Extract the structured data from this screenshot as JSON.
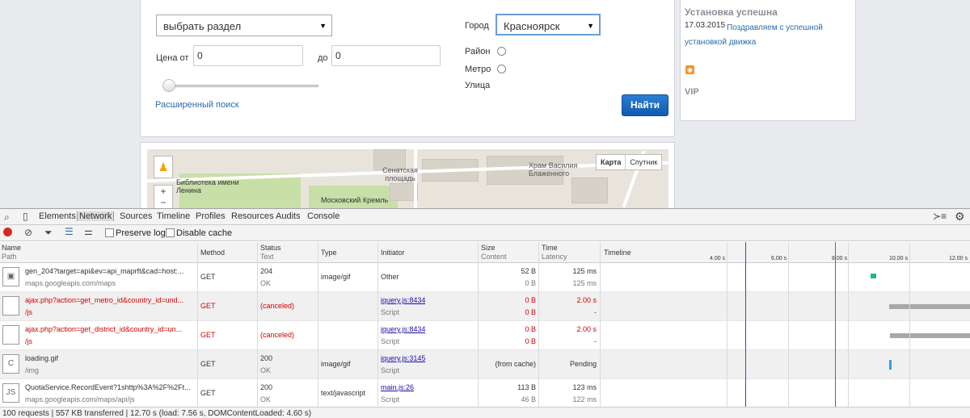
{
  "search": {
    "section_select": "выбрать раздел",
    "city_label": "Город",
    "city_value": "Красноярск",
    "price_from_label": "Цена от",
    "price_from_value": "0",
    "price_to_label": "до",
    "price_to_value": "0",
    "district_label": "Район",
    "metro_label": "Метро",
    "street_label": "Улица",
    "advanced_link": "Расширенный поиск",
    "find_button": "Найти"
  },
  "side": {
    "title": "Установка успешна",
    "date": "17.03.2015",
    "news_text": "Поздравляем с успешной установкой движка",
    "vip": "VIP"
  },
  "map": {
    "labels": [
      "Сенатская площадь",
      "Храм Василия Блаженного",
      "Библиотека имени Ленина",
      "Московский Кремль"
    ],
    "type_map": "Карта",
    "type_satellite": "Спутник"
  },
  "devtools": {
    "tabs": [
      "Elements",
      "Network",
      "Sources",
      "Timeline",
      "Profiles",
      "Resources",
      "Audits",
      "Console"
    ],
    "active_tab": "Network",
    "preserve_log": "Preserve log",
    "disable_cache": "Disable cache",
    "headers": {
      "name": "Name",
      "path": "Path",
      "method": "Method",
      "status": "Status",
      "text": "Text",
      "type": "Type",
      "initiator": "Initiator",
      "size": "Size",
      "content": "Content",
      "time": "Time",
      "latency": "Latency",
      "timeline": "Timeline"
    },
    "ticks": [
      "4.00 s",
      "6.00 s",
      "8.00 s",
      "10.00 s",
      "12.00 s"
    ],
    "rows": [
      {
        "name": "gen_204?target=api&ev=api_maprft&cad=host:...",
        "path": "maps.googleapis.com/maps",
        "method": "GET",
        "status": "204",
        "text": "OK",
        "type": "image/gif",
        "initiator": "Other",
        "initiator_sub": "",
        "size": "52 B",
        "content": "0 B",
        "time": "125 ms",
        "latency": "125 ms",
        "error": false
      },
      {
        "name": "ajax.php?action=get_metro_id&country_id=und...",
        "path": "/js",
        "method": "GET",
        "status": "(canceled)",
        "text": "",
        "type": "",
        "initiator": "jquery.js:8434",
        "initiator_sub": "Script",
        "size": "0 B",
        "content": "0 B",
        "time": "2.00 s",
        "latency": "-",
        "error": true
      },
      {
        "name": "ajax.php?action=get_district_id&country_id=un...",
        "path": "/js",
        "method": "GET",
        "status": "(canceled)",
        "text": "",
        "type": "",
        "initiator": "jquery.js:8434",
        "initiator_sub": "Script",
        "size": "0 B",
        "content": "0 B",
        "time": "2.00 s",
        "latency": "-",
        "error": true
      },
      {
        "name": "loading.gif",
        "path": "/img",
        "method": "GET",
        "status": "200",
        "text": "OK",
        "type": "image/gif",
        "initiator": "jquery.js:3145",
        "initiator_sub": "Script",
        "size": "(from cache)",
        "content": "",
        "time": "Pending",
        "latency": "",
        "error": false
      },
      {
        "name": "QuotaService.RecordEvent?1shttp%3A%2F%2Ft...",
        "path": "maps.googleapis.com/maps/api/js",
        "method": "GET",
        "status": "200",
        "text": "OK",
        "type": "text/javascript",
        "initiator": "main.js:26",
        "initiator_sub": "Script",
        "size": "113 B",
        "content": "46 B",
        "time": "123 ms",
        "latency": "122 ms",
        "error": false
      }
    ],
    "status_bar": "100 requests | 557 KB transferred | 12.70 s (load: 7.56 s, DOMContentLoaded: 4.60 s)",
    "colors": {
      "dom_line": "#3b3bd6",
      "load_line": "#e0383c",
      "bar_green": "#1bbd7e",
      "bar_gray": "#a8a8a8",
      "bar_blue": "#2aa3e8"
    }
  }
}
